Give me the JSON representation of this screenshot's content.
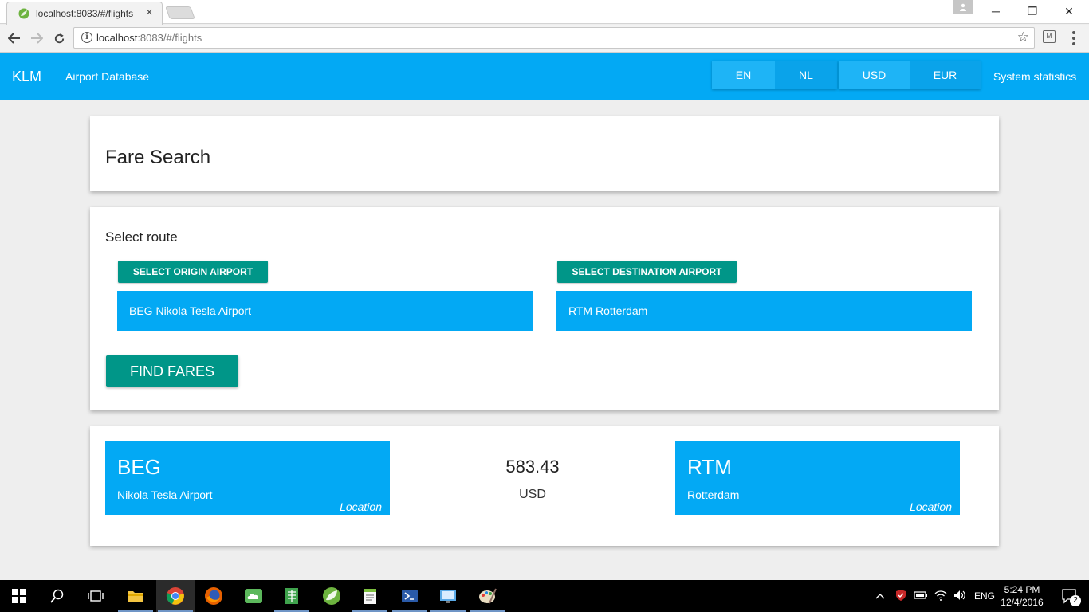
{
  "browser": {
    "tab_title": "localhost:8083/#/flights",
    "tab_close": "×",
    "url_host": "localhost",
    "url_path": ":8083/#/flights",
    "window_controls": {
      "minimize": "─",
      "restore": "❐",
      "close": "✕"
    }
  },
  "header": {
    "brand": "KLM",
    "nav_link": "Airport Database",
    "languages": [
      {
        "label": "EN",
        "selected": true
      },
      {
        "label": "NL",
        "selected": false
      }
    ],
    "currencies": [
      {
        "label": "USD",
        "selected": true
      },
      {
        "label": "EUR",
        "selected": false
      }
    ],
    "stats_link": "System statistics",
    "accent_color": "#03a9f4"
  },
  "page": {
    "title": "Fare Search"
  },
  "route": {
    "label": "Select route",
    "origin_button": "SELECT ORIGIN AIRPORT",
    "destination_button": "SELECT DESTINATION AIRPORT",
    "origin_value": "BEG Nikola Tesla Airport",
    "destination_value": "RTM Rotterdam",
    "find_button": "FIND FARES",
    "button_color": "#009688"
  },
  "result": {
    "origin": {
      "code": "BEG",
      "name": "Nikola Tesla Airport",
      "location_label": "Location"
    },
    "destination": {
      "code": "RTM",
      "name": "Rotterdam",
      "location_label": "Location"
    },
    "amount": "583.43",
    "currency": "USD"
  },
  "taskbar": {
    "apps": [
      "start-icon",
      "search-icon",
      "task-view-icon",
      "file-explorer-icon",
      "chrome-icon",
      "firefox-icon",
      "cloud-app-icon",
      "spreadsheet-icon",
      "spring-icon",
      "notepad-icon",
      "powershell-icon",
      "control-panel-icon",
      "paint-icon"
    ],
    "language": "ENG",
    "time": "5:24 PM",
    "date": "12/4/2016",
    "notifications": "2"
  }
}
